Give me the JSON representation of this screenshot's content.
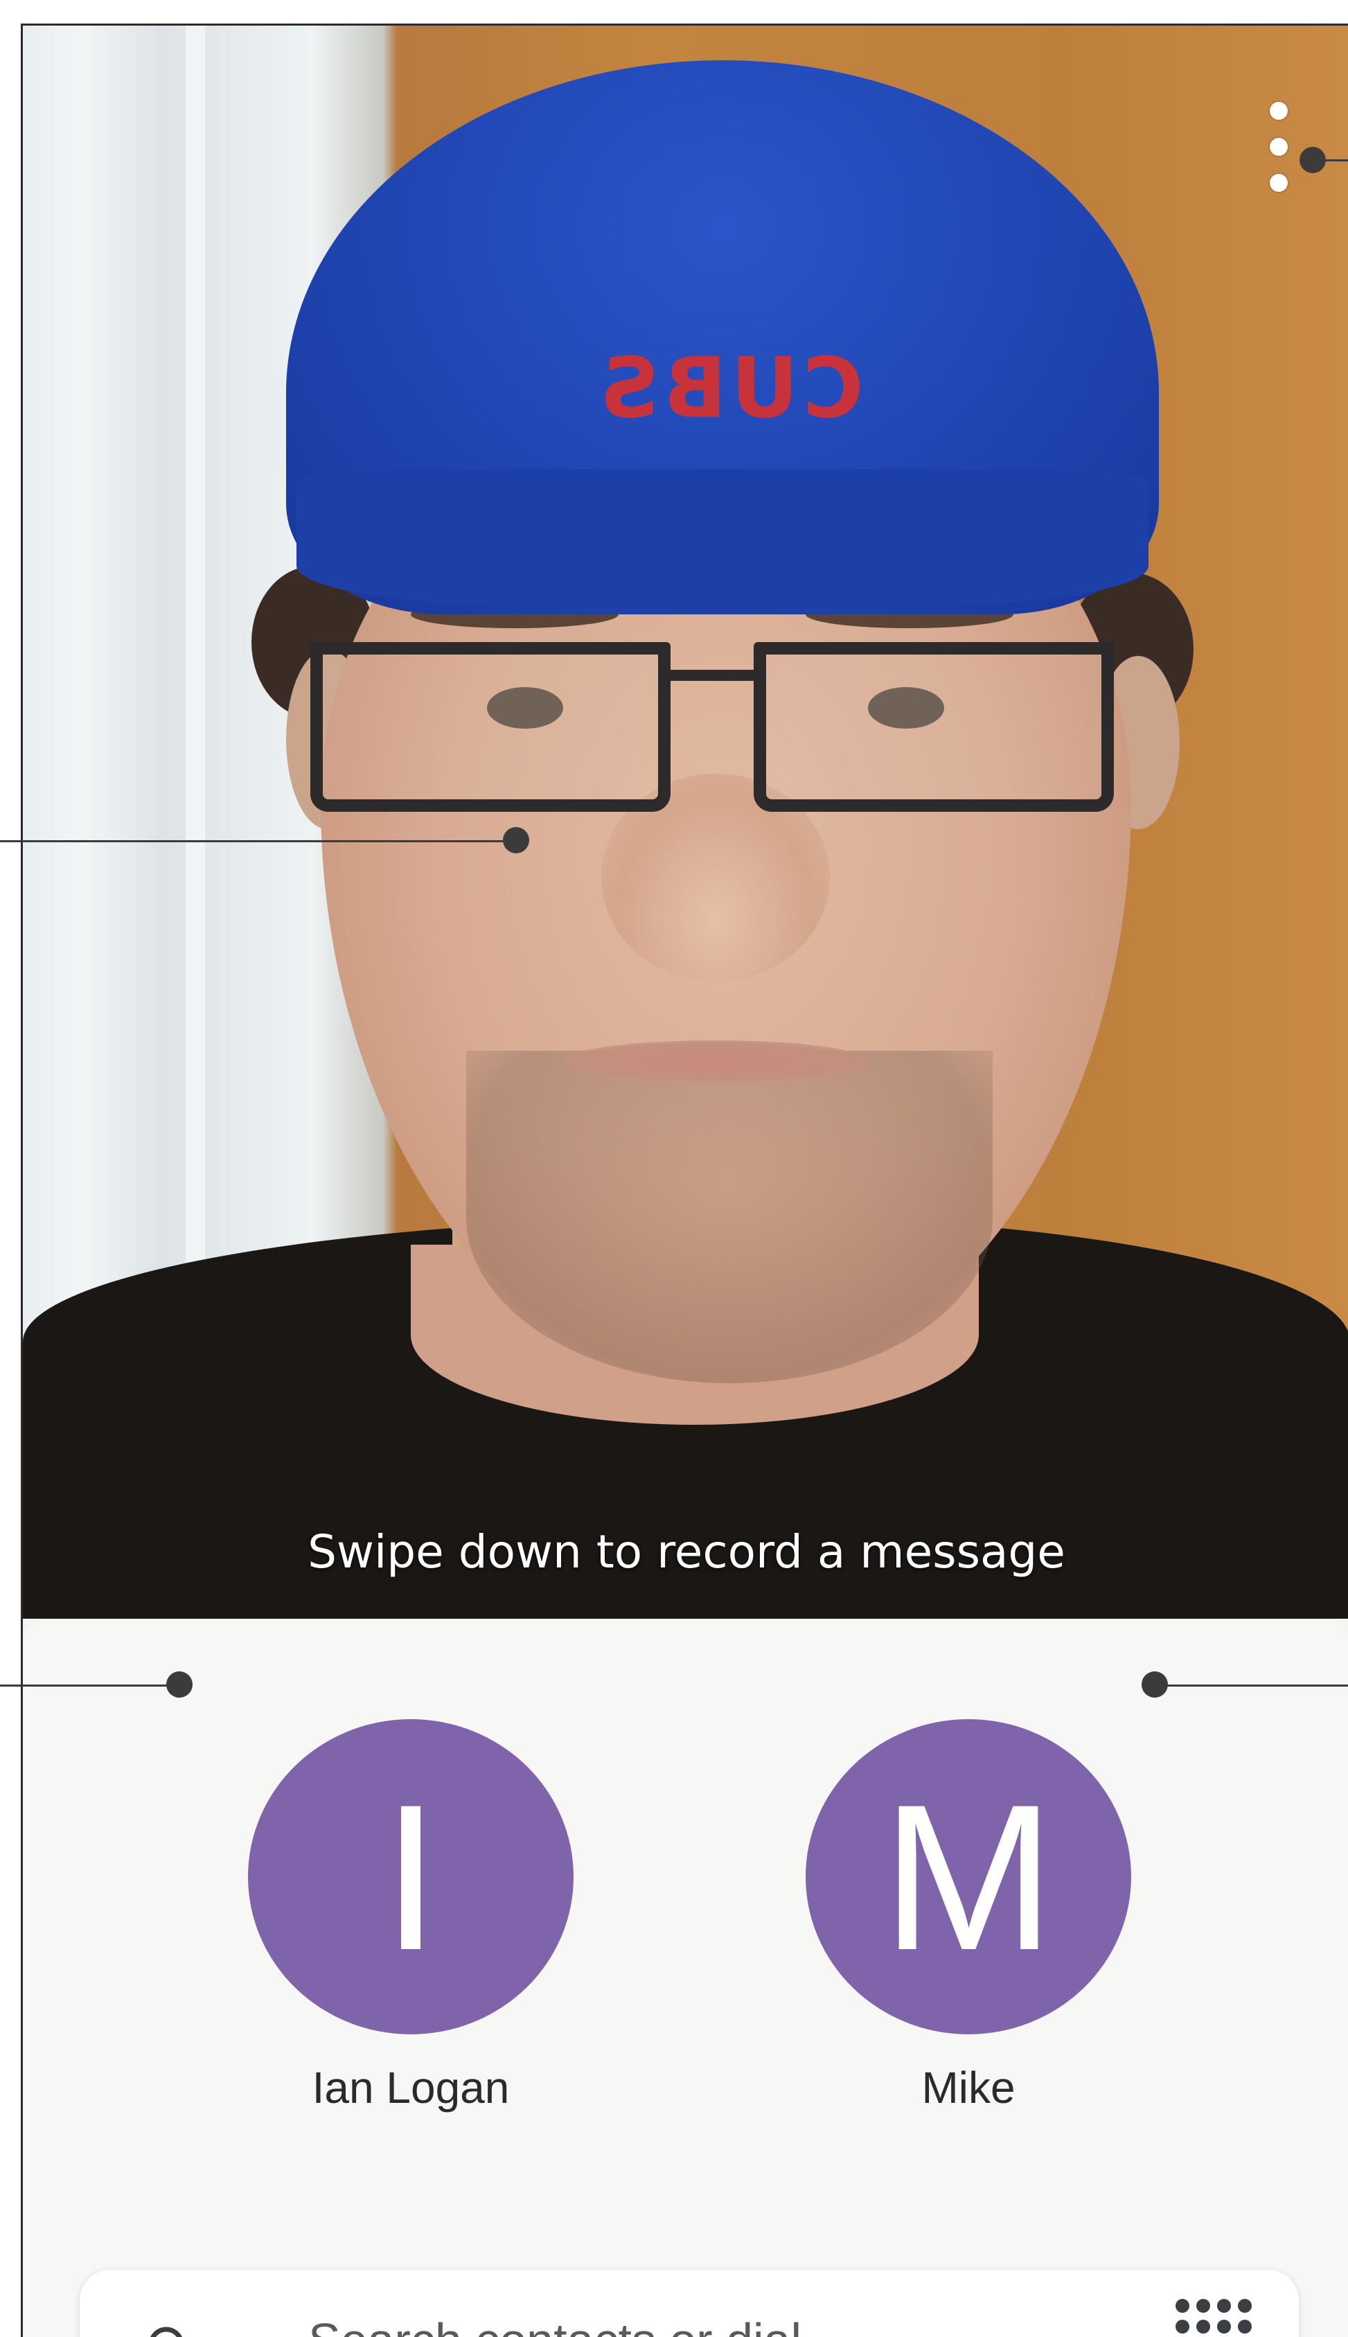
{
  "camera": {
    "hat_logo": "CUBS",
    "swipe_hint": "Swipe down to record a message"
  },
  "contacts": [
    {
      "initial": "I",
      "name": "Ian Logan"
    },
    {
      "initial": "M",
      "name": "Mike"
    }
  ],
  "search": {
    "placeholder": "Search contacts or dial"
  },
  "colors": {
    "avatar": "#7f63ab",
    "sheet": "#f7f7f5",
    "hat": "#1f44b0"
  },
  "icons": [
    "more-vertical-icon",
    "search-icon",
    "dialpad-icon"
  ]
}
